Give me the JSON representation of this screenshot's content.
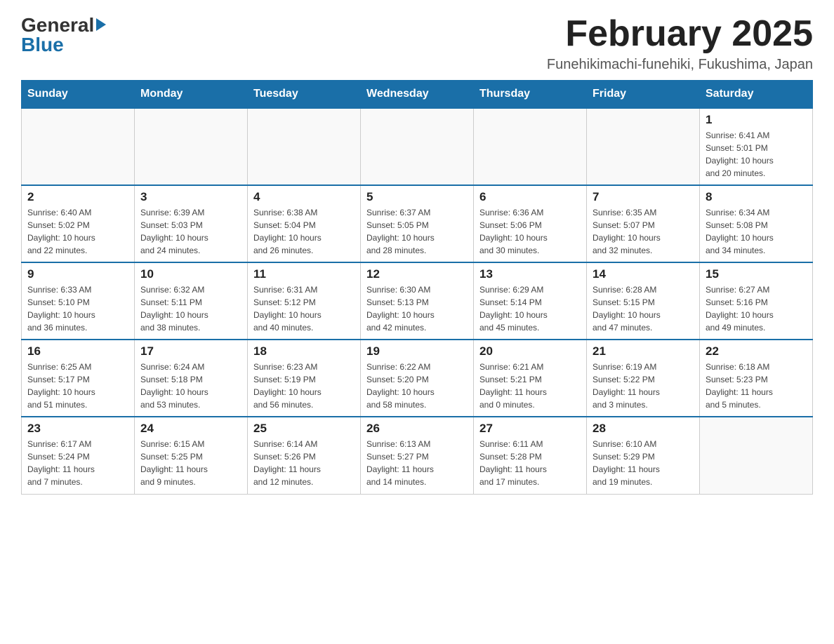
{
  "header": {
    "logo_general": "General",
    "logo_blue": "Blue",
    "month_title": "February 2025",
    "location": "Funehikimachi-funehiki, Fukushima, Japan"
  },
  "weekdays": [
    "Sunday",
    "Monday",
    "Tuesday",
    "Wednesday",
    "Thursday",
    "Friday",
    "Saturday"
  ],
  "weeks": [
    [
      {
        "day": "",
        "info": ""
      },
      {
        "day": "",
        "info": ""
      },
      {
        "day": "",
        "info": ""
      },
      {
        "day": "",
        "info": ""
      },
      {
        "day": "",
        "info": ""
      },
      {
        "day": "",
        "info": ""
      },
      {
        "day": "1",
        "info": "Sunrise: 6:41 AM\nSunset: 5:01 PM\nDaylight: 10 hours\nand 20 minutes."
      }
    ],
    [
      {
        "day": "2",
        "info": "Sunrise: 6:40 AM\nSunset: 5:02 PM\nDaylight: 10 hours\nand 22 minutes."
      },
      {
        "day": "3",
        "info": "Sunrise: 6:39 AM\nSunset: 5:03 PM\nDaylight: 10 hours\nand 24 minutes."
      },
      {
        "day": "4",
        "info": "Sunrise: 6:38 AM\nSunset: 5:04 PM\nDaylight: 10 hours\nand 26 minutes."
      },
      {
        "day": "5",
        "info": "Sunrise: 6:37 AM\nSunset: 5:05 PM\nDaylight: 10 hours\nand 28 minutes."
      },
      {
        "day": "6",
        "info": "Sunrise: 6:36 AM\nSunset: 5:06 PM\nDaylight: 10 hours\nand 30 minutes."
      },
      {
        "day": "7",
        "info": "Sunrise: 6:35 AM\nSunset: 5:07 PM\nDaylight: 10 hours\nand 32 minutes."
      },
      {
        "day": "8",
        "info": "Sunrise: 6:34 AM\nSunset: 5:08 PM\nDaylight: 10 hours\nand 34 minutes."
      }
    ],
    [
      {
        "day": "9",
        "info": "Sunrise: 6:33 AM\nSunset: 5:10 PM\nDaylight: 10 hours\nand 36 minutes."
      },
      {
        "day": "10",
        "info": "Sunrise: 6:32 AM\nSunset: 5:11 PM\nDaylight: 10 hours\nand 38 minutes."
      },
      {
        "day": "11",
        "info": "Sunrise: 6:31 AM\nSunset: 5:12 PM\nDaylight: 10 hours\nand 40 minutes."
      },
      {
        "day": "12",
        "info": "Sunrise: 6:30 AM\nSunset: 5:13 PM\nDaylight: 10 hours\nand 42 minutes."
      },
      {
        "day": "13",
        "info": "Sunrise: 6:29 AM\nSunset: 5:14 PM\nDaylight: 10 hours\nand 45 minutes."
      },
      {
        "day": "14",
        "info": "Sunrise: 6:28 AM\nSunset: 5:15 PM\nDaylight: 10 hours\nand 47 minutes."
      },
      {
        "day": "15",
        "info": "Sunrise: 6:27 AM\nSunset: 5:16 PM\nDaylight: 10 hours\nand 49 minutes."
      }
    ],
    [
      {
        "day": "16",
        "info": "Sunrise: 6:25 AM\nSunset: 5:17 PM\nDaylight: 10 hours\nand 51 minutes."
      },
      {
        "day": "17",
        "info": "Sunrise: 6:24 AM\nSunset: 5:18 PM\nDaylight: 10 hours\nand 53 minutes."
      },
      {
        "day": "18",
        "info": "Sunrise: 6:23 AM\nSunset: 5:19 PM\nDaylight: 10 hours\nand 56 minutes."
      },
      {
        "day": "19",
        "info": "Sunrise: 6:22 AM\nSunset: 5:20 PM\nDaylight: 10 hours\nand 58 minutes."
      },
      {
        "day": "20",
        "info": "Sunrise: 6:21 AM\nSunset: 5:21 PM\nDaylight: 11 hours\nand 0 minutes."
      },
      {
        "day": "21",
        "info": "Sunrise: 6:19 AM\nSunset: 5:22 PM\nDaylight: 11 hours\nand 3 minutes."
      },
      {
        "day": "22",
        "info": "Sunrise: 6:18 AM\nSunset: 5:23 PM\nDaylight: 11 hours\nand 5 minutes."
      }
    ],
    [
      {
        "day": "23",
        "info": "Sunrise: 6:17 AM\nSunset: 5:24 PM\nDaylight: 11 hours\nand 7 minutes."
      },
      {
        "day": "24",
        "info": "Sunrise: 6:15 AM\nSunset: 5:25 PM\nDaylight: 11 hours\nand 9 minutes."
      },
      {
        "day": "25",
        "info": "Sunrise: 6:14 AM\nSunset: 5:26 PM\nDaylight: 11 hours\nand 12 minutes."
      },
      {
        "day": "26",
        "info": "Sunrise: 6:13 AM\nSunset: 5:27 PM\nDaylight: 11 hours\nand 14 minutes."
      },
      {
        "day": "27",
        "info": "Sunrise: 6:11 AM\nSunset: 5:28 PM\nDaylight: 11 hours\nand 17 minutes."
      },
      {
        "day": "28",
        "info": "Sunrise: 6:10 AM\nSunset: 5:29 PM\nDaylight: 11 hours\nand 19 minutes."
      },
      {
        "day": "",
        "info": ""
      }
    ]
  ]
}
